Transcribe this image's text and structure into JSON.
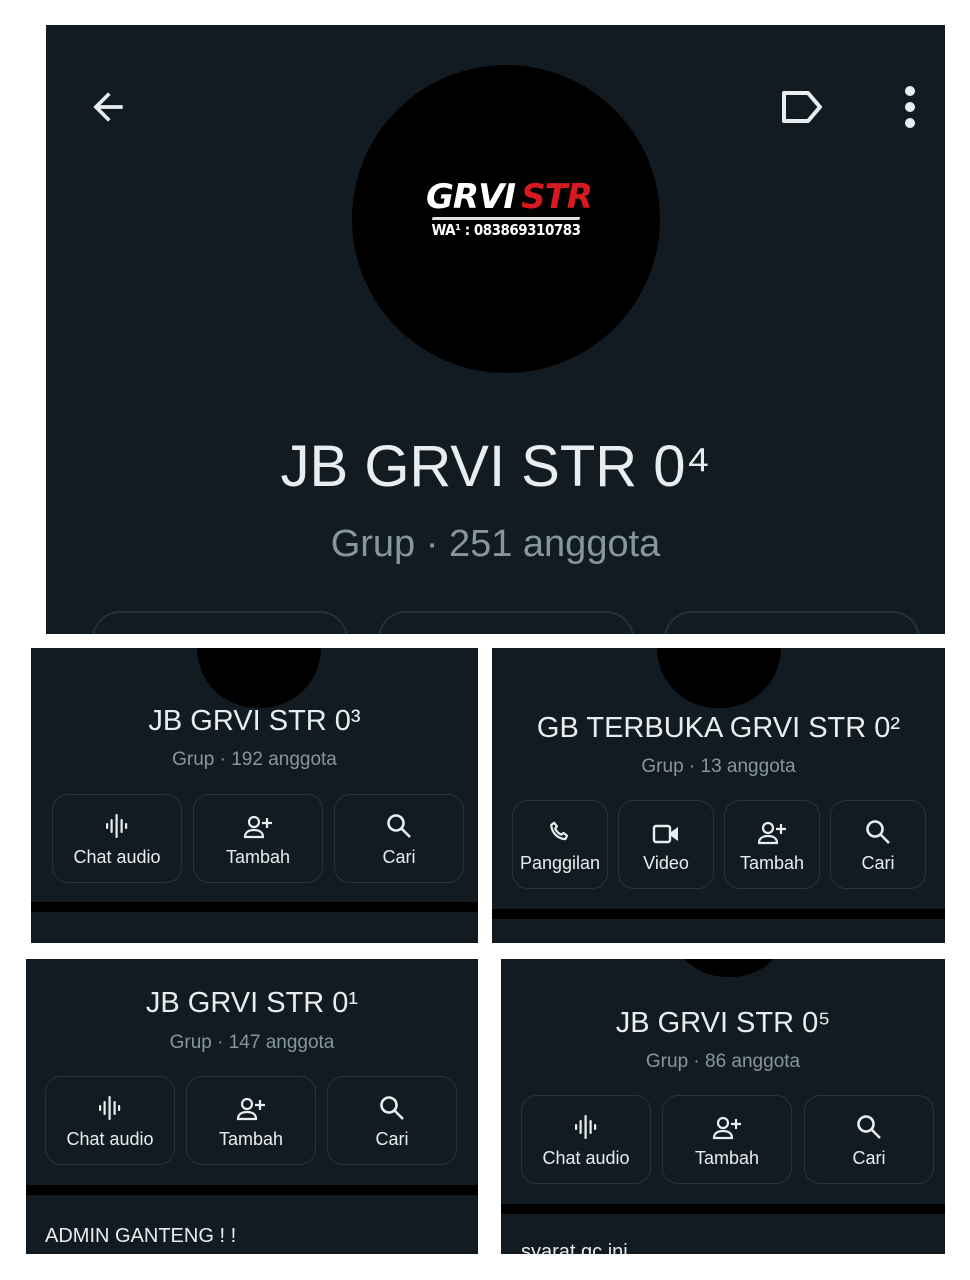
{
  "top_panel": {
    "logo": {
      "text_white": "GRVI",
      "text_red": "STR",
      "contact": "WA¹ : 083869310783"
    },
    "title": "JB GRVI STR 0⁴",
    "subtitle": "Grup · 251 anggota",
    "icons": {
      "back": "arrow-left-icon",
      "label": "label-tag-icon",
      "menu": "more-vert-icon"
    }
  },
  "panel_03": {
    "title": "JB GRVI STR 0³",
    "subtitle": "Grup · 192 anggota",
    "actions": [
      {
        "label": "Chat audio",
        "icon": "audio-wave-icon"
      },
      {
        "label": "Tambah",
        "icon": "add-person-icon"
      },
      {
        "label": "Cari",
        "icon": "search-icon"
      }
    ]
  },
  "panel_02": {
    "title": "GB TERBUKA GRVI STR 0²",
    "subtitle": "Grup · 13 anggota",
    "actions": [
      {
        "label": "Panggilan",
        "icon": "phone-icon"
      },
      {
        "label": "Video",
        "icon": "video-icon"
      },
      {
        "label": "Tambah",
        "icon": "add-person-icon"
      },
      {
        "label": "Cari",
        "icon": "search-icon"
      }
    ]
  },
  "panel_01": {
    "title": "JB GRVI STR 0¹",
    "subtitle": "Grup · 147 anggota",
    "actions": [
      {
        "label": "Chat audio",
        "icon": "audio-wave-icon"
      },
      {
        "label": "Tambah",
        "icon": "add-person-icon"
      },
      {
        "label": "Cari",
        "icon": "search-icon"
      }
    ],
    "description": "ADMIN GANTENG ! !"
  },
  "panel_05": {
    "title": "JB GRVI STR 0⁵",
    "subtitle": "Grup · 86 anggota",
    "actions": [
      {
        "label": "Chat audio",
        "icon": "audio-wave-icon"
      },
      {
        "label": "Tambah",
        "icon": "add-person-icon"
      },
      {
        "label": "Cari",
        "icon": "search-icon"
      }
    ],
    "description": "syarat gc ini"
  },
  "colors": {
    "background": "#111b21",
    "text_primary": "#e9edef",
    "text_secondary": "#8696a0",
    "button_border": "#26343c",
    "logo_red": "#d8191f"
  }
}
